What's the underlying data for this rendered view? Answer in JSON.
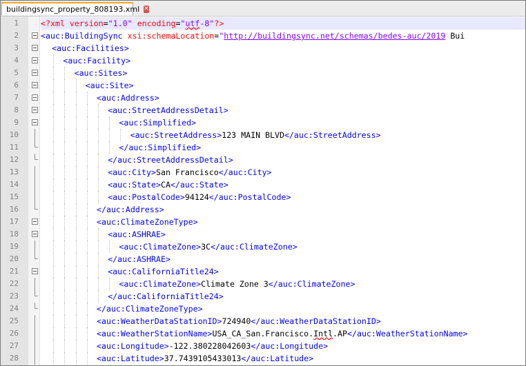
{
  "tab": {
    "filename": "buildingsync_property_808193.xml",
    "close_glyph": "✕"
  },
  "lines": [
    {
      "n": "1",
      "indent": 0,
      "fold": "none",
      "parts": [
        {
          "c": "pi",
          "t": "<?xml "
        },
        {
          "c": "attr",
          "t": "version"
        },
        {
          "c": "eq",
          "t": "="
        },
        {
          "c": "val",
          "t": "\"1.0\""
        },
        {
          "c": "attr",
          "t": " encoding"
        },
        {
          "c": "eq",
          "t": "="
        },
        {
          "c": "val",
          "t": "\""
        },
        {
          "c": "val squig",
          "t": "utf"
        },
        {
          "c": "val",
          "t": "-8\""
        },
        {
          "c": "pi",
          "t": "?>"
        }
      ],
      "current": true
    },
    {
      "n": "2",
      "indent": 0,
      "fold": "open",
      "parts": [
        {
          "c": "tag",
          "t": "<auc:BuildingSync "
        },
        {
          "c": "attr",
          "t": "xsi:schemaLocation"
        },
        {
          "c": "eq",
          "t": "="
        },
        {
          "c": "val",
          "t": "\""
        },
        {
          "c": "url",
          "t": "http://buildingsync.net/schemas/bedes-auc/2019"
        },
        {
          "c": "txt",
          "t": " Bui"
        }
      ]
    },
    {
      "n": "3",
      "indent": 1,
      "fold": "open",
      "parts": [
        {
          "c": "tag",
          "t": "<auc:Facilities>"
        }
      ]
    },
    {
      "n": "4",
      "indent": 2,
      "fold": "open",
      "parts": [
        {
          "c": "tag",
          "t": "<auc:Facility>"
        }
      ]
    },
    {
      "n": "5",
      "indent": 3,
      "fold": "open",
      "parts": [
        {
          "c": "tag",
          "t": "<auc:Sites>"
        }
      ]
    },
    {
      "n": "6",
      "indent": 4,
      "fold": "open",
      "parts": [
        {
          "c": "tag",
          "t": "<auc:Site>"
        }
      ]
    },
    {
      "n": "7",
      "indent": 5,
      "fold": "open",
      "parts": [
        {
          "c": "tag",
          "t": "<auc:Address>"
        }
      ]
    },
    {
      "n": "8",
      "indent": 6,
      "fold": "open",
      "parts": [
        {
          "c": "tag",
          "t": "<auc:StreetAddressDetail>"
        }
      ]
    },
    {
      "n": "9",
      "indent": 7,
      "fold": "open",
      "parts": [
        {
          "c": "tag",
          "t": "<auc:Simplified>"
        }
      ]
    },
    {
      "n": "10",
      "indent": 8,
      "fold": "line",
      "parts": [
        {
          "c": "tag",
          "t": "<auc:StreetAddress>"
        },
        {
          "c": "txt",
          "t": "123 MAIN BLVD"
        },
        {
          "c": "tag",
          "t": "</auc:StreetAddress>"
        }
      ]
    },
    {
      "n": "11",
      "indent": 7,
      "fold": "end",
      "parts": [
        {
          "c": "tag",
          "t": "</auc:Simplified>"
        }
      ]
    },
    {
      "n": "12",
      "indent": 6,
      "fold": "end",
      "parts": [
        {
          "c": "tag",
          "t": "</auc:StreetAddressDetail>"
        }
      ]
    },
    {
      "n": "13",
      "indent": 6,
      "fold": "line",
      "parts": [
        {
          "c": "tag",
          "t": "<auc:City>"
        },
        {
          "c": "txt",
          "t": "San Francisco"
        },
        {
          "c": "tag",
          "t": "</auc:City>"
        }
      ]
    },
    {
      "n": "14",
      "indent": 6,
      "fold": "line",
      "parts": [
        {
          "c": "tag",
          "t": "<auc:State>"
        },
        {
          "c": "txt",
          "t": "CA"
        },
        {
          "c": "tag",
          "t": "</auc:State>"
        }
      ]
    },
    {
      "n": "15",
      "indent": 6,
      "fold": "line",
      "parts": [
        {
          "c": "tag",
          "t": "<auc:PostalCode>"
        },
        {
          "c": "txt",
          "t": "94124"
        },
        {
          "c": "tag",
          "t": "</auc:PostalCode>"
        }
      ]
    },
    {
      "n": "16",
      "indent": 5,
      "fold": "end",
      "parts": [
        {
          "c": "tag",
          "t": "</auc:Address>"
        }
      ]
    },
    {
      "n": "17",
      "indent": 5,
      "fold": "open",
      "parts": [
        {
          "c": "tag",
          "t": "<auc:ClimateZoneType>"
        }
      ]
    },
    {
      "n": "18",
      "indent": 6,
      "fold": "open",
      "parts": [
        {
          "c": "tag",
          "t": "<auc:ASHRAE>"
        }
      ]
    },
    {
      "n": "19",
      "indent": 7,
      "fold": "line",
      "parts": [
        {
          "c": "tag",
          "t": "<auc:ClimateZone>"
        },
        {
          "c": "txt",
          "t": "3C"
        },
        {
          "c": "tag",
          "t": "</auc:ClimateZone>"
        }
      ]
    },
    {
      "n": "20",
      "indent": 6,
      "fold": "end",
      "parts": [
        {
          "c": "tag",
          "t": "</auc:ASHRAE>"
        }
      ]
    },
    {
      "n": "21",
      "indent": 6,
      "fold": "open",
      "parts": [
        {
          "c": "tag",
          "t": "<auc:CaliforniaTitle24>"
        }
      ]
    },
    {
      "n": "22",
      "indent": 7,
      "fold": "line",
      "parts": [
        {
          "c": "tag",
          "t": "<auc:ClimateZone>"
        },
        {
          "c": "txt",
          "t": "Climate Zone 3"
        },
        {
          "c": "tag",
          "t": "</auc:ClimateZone>"
        }
      ]
    },
    {
      "n": "23",
      "indent": 6,
      "fold": "end",
      "parts": [
        {
          "c": "tag",
          "t": "</auc:CaliforniaTitle24>"
        }
      ]
    },
    {
      "n": "24",
      "indent": 5,
      "fold": "end",
      "parts": [
        {
          "c": "tag",
          "t": "</auc:ClimateZoneType>"
        }
      ]
    },
    {
      "n": "25",
      "indent": 5,
      "fold": "line",
      "parts": [
        {
          "c": "tag",
          "t": "<auc:WeatherDataStationID>"
        },
        {
          "c": "txt",
          "t": "724940"
        },
        {
          "c": "tag",
          "t": "</auc:WeatherDataStationID>"
        }
      ]
    },
    {
      "n": "26",
      "indent": 5,
      "fold": "line",
      "parts": [
        {
          "c": "tag",
          "t": "<auc:WeatherStationName>"
        },
        {
          "c": "txt",
          "t": "USA_CA_San.Francisco."
        },
        {
          "c": "txt squig",
          "t": "Intl"
        },
        {
          "c": "txt",
          "t": ".AP"
        },
        {
          "c": "tag",
          "t": "</auc:WeatherStationName>"
        }
      ]
    },
    {
      "n": "27",
      "indent": 5,
      "fold": "line",
      "parts": [
        {
          "c": "tag",
          "t": "<auc:Longitude>"
        },
        {
          "c": "txt",
          "t": "-122.380228042603"
        },
        {
          "c": "tag",
          "t": "</auc:Longitude>"
        }
      ]
    },
    {
      "n": "28",
      "indent": 5,
      "fold": "line",
      "parts": [
        {
          "c": "tag",
          "t": "<auc:Latitude>"
        },
        {
          "c": "txt",
          "t": "37.7439105433013"
        },
        {
          "c": "tag",
          "t": "</auc:Latitude>"
        }
      ]
    }
  ]
}
